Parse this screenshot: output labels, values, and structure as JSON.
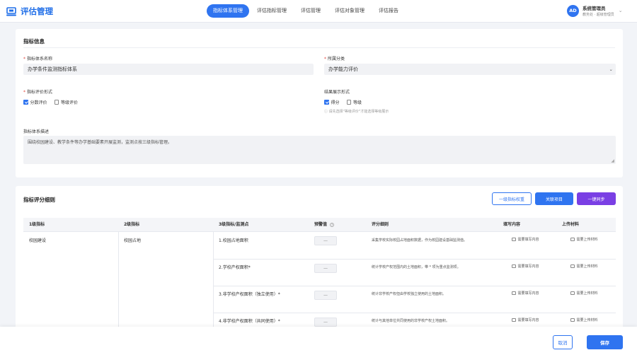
{
  "app": {
    "title": "评估管理",
    "brand_color": "#1f6ee8"
  },
  "nav": {
    "items": [
      {
        "label": "指标体系管理",
        "active": true
      },
      {
        "label": "评估指标管理",
        "active": false
      },
      {
        "label": "评估管理",
        "active": false
      },
      {
        "label": "评估对象管理",
        "active": false
      },
      {
        "label": "评估报告",
        "active": false
      }
    ]
  },
  "user": {
    "avatar": "AD",
    "name": "系统管理员",
    "role": "教务处 · 超级管理员"
  },
  "info": {
    "title": "指标信息",
    "name_label": "指标体系名称",
    "name_value": "办学条件监测指标体系",
    "category_label": "所属分类",
    "category_value": "办学能力评价",
    "eval_form_label": "指标评价形式",
    "eval_form_options": [
      {
        "label": "分数评价",
        "checked": true
      },
      {
        "label": "等级评价",
        "checked": false
      }
    ],
    "result_form_label": "结果展示形式",
    "result_form_options": [
      {
        "label": "得分",
        "checked": true
      },
      {
        "label": "等级",
        "checked": false
      }
    ],
    "result_hint": "ⓘ 请先选择\"等级评价\"才能选择等级展示",
    "desc_label": "指标体系描述",
    "desc_value": "围绕校园建设、教学条件等办学基础要素开展监测，监测点按三级指标管理。"
  },
  "detail": {
    "title": "指标评分细则",
    "btn_weight": "一级指标权重",
    "btn_link": "关联项目",
    "btn_sync": "一键同步",
    "columns": [
      "1级指标",
      "2级指标",
      "3级指标/监测点",
      "预警值",
      "评分细则",
      "填写内容",
      "上传材料"
    ],
    "rows": [
      {
        "l1": "校园建设",
        "l2": "校园占地",
        "l3": "1.校园占地面积",
        "warn": "—",
        "rule": "采集学校实际校园占地面积数据，作为校园建设基础监测值。",
        "fill": "需要填写内容",
        "upload": "需要上传材料"
      },
      {
        "l1": "",
        "l2": "",
        "l3": "2.学校产权面积*",
        "warn": "—",
        "rule": "统计学校产权范围内的土地面积，带 * 项为重点监测项。",
        "fill": "需要填写内容",
        "upload": "需要上传材料"
      },
      {
        "l1": "",
        "l2": "",
        "l3": "3.非学校产权面积（独立使用）*",
        "warn": "—",
        "rule": "统计非学校产权但由学校独立使用的土地面积。",
        "fill": "需要填写内容",
        "upload": "需要上传材料"
      },
      {
        "l1": "",
        "l2": "",
        "l3": "4.非学校产权面积（共同使用）*",
        "warn": "—",
        "rule": "统计与其他单位共同使用的非学校产权土地面积。",
        "fill": "需要填写内容",
        "upload": "需要上传材料"
      }
    ]
  },
  "footer": {
    "cancel": "取消",
    "save": "保存"
  }
}
